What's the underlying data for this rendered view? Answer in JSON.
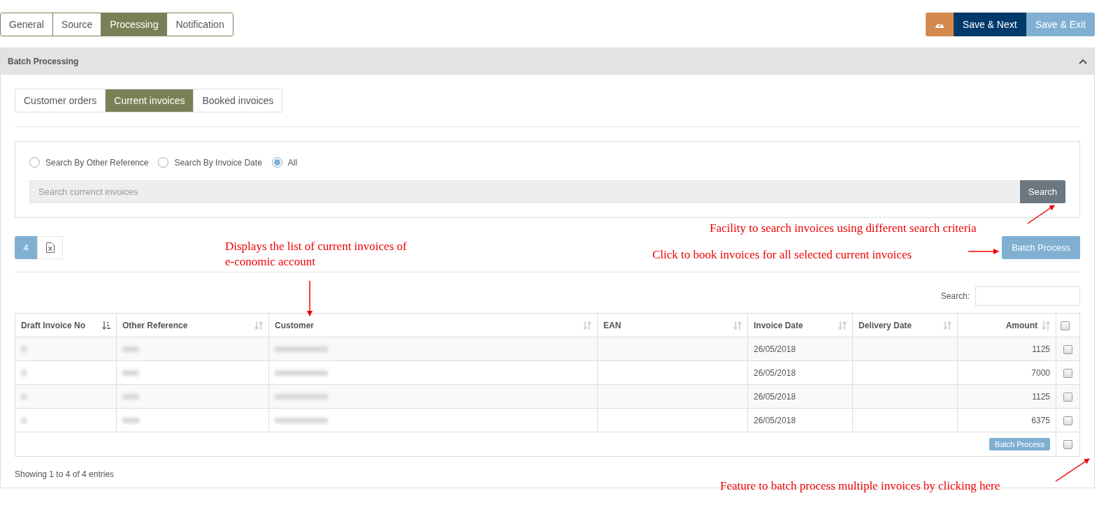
{
  "top_tabs": [
    {
      "label": "General",
      "selected": false
    },
    {
      "label": "Source",
      "selected": false
    },
    {
      "label": "Processing",
      "selected": true
    },
    {
      "label": "Notification",
      "selected": false
    }
  ],
  "actions": [
    {
      "kind": "icon"
    },
    {
      "kind": "primary",
      "label": "Save & Next"
    },
    {
      "kind": "light",
      "label": "Save & Exit"
    }
  ],
  "panel": {
    "title": "Batch Processing",
    "expanded": true
  },
  "sub_tabs": [
    {
      "label": "Customer orders",
      "selected": false
    },
    {
      "label": "Current invoices",
      "selected": true
    },
    {
      "label": "Booked invoices",
      "selected": false
    }
  ],
  "search_options": [
    {
      "label": "Search By Other Reference",
      "selected": false
    },
    {
      "label": "Search By Invoice Date",
      "selected": false
    },
    {
      "label": "All",
      "selected": true
    }
  ],
  "search_field": {
    "placeholder": "Search currenct invoices"
  },
  "search_button": "Search",
  "count_badge": "4",
  "batch_button": "Batch Process",
  "table_search_label": "Search:",
  "columns": [
    {
      "label": "Draft Invoice No",
      "sorted": true
    },
    {
      "label": "Other Reference",
      "sorted": false
    },
    {
      "label": "Customer",
      "sorted": false
    },
    {
      "label": "EAN",
      "sorted": false
    },
    {
      "label": "Invoice Date",
      "sorted": false
    },
    {
      "label": "Delivery Date",
      "sorted": false
    },
    {
      "label": "Amount",
      "sorted": false
    }
  ],
  "header_checkbox": {
    "checked": false
  },
  "rows": [
    {
      "blurred": true,
      "invoice_date": "26/05/2018",
      "amount": "1125",
      "checked": false
    },
    {
      "blurred": true,
      "invoice_date": "26/05/2018",
      "amount": "7000",
      "checked": false
    },
    {
      "blurred": true,
      "invoice_date": "26/05/2018",
      "amount": "1125",
      "checked": false
    },
    {
      "blurred": true,
      "invoice_date": "26/05/2018",
      "amount": "6375",
      "checked": false
    }
  ],
  "footer_batch_button": "Batch Process",
  "footer_checkbox": {
    "checked": false
  },
  "entries_info": "Showing 1 to 4 of 4 entries",
  "annotations": [
    {
      "text": "Facility to search invoices using different search criteria"
    },
    {
      "text": "Displays the list of current invoices of e-conomic account"
    },
    {
      "text": "Click to book invoices for all selected current invoices"
    },
    {
      "text": "Feature to batch process multiple invoices by clicking here"
    }
  ]
}
